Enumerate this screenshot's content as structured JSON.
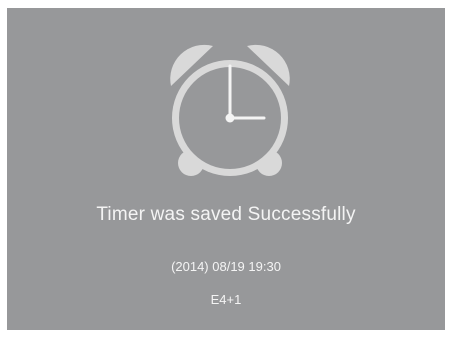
{
  "dialog": {
    "icon": "alarm-clock-icon",
    "message": "Timer was saved Successfully",
    "datetime": "(2014) 08/19 19:30",
    "channel": "E4+1"
  },
  "colors": {
    "background": "#97989a",
    "foreground": "#d9d9d9",
    "hands": "#f4f4f4",
    "text": "#f4f4f4"
  }
}
